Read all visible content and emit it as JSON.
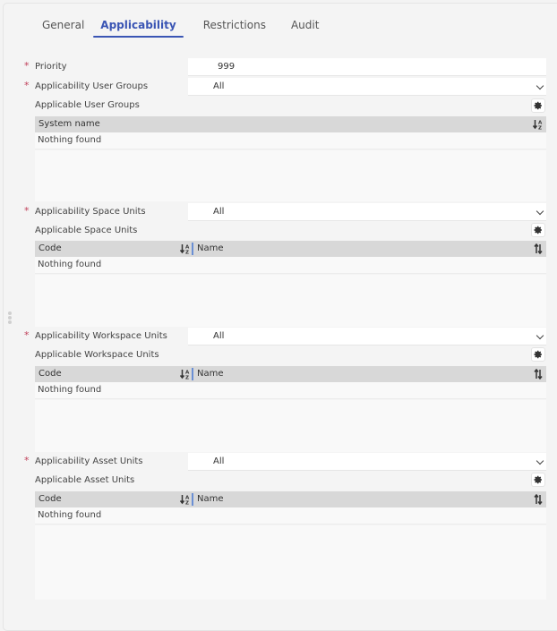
{
  "tabs": [
    {
      "label": "General",
      "active": false
    },
    {
      "label": "Applicability",
      "active": true
    },
    {
      "label": "Restrictions",
      "active": false
    },
    {
      "label": "Audit",
      "active": false
    }
  ],
  "colors": {
    "accent": "#3a55b4",
    "required": "#c0405a",
    "grid_header": "#d8d8d8"
  },
  "priority": {
    "label": "Priority",
    "required": true,
    "value": "999"
  },
  "sections": [
    {
      "select_label": "Applicability User Groups",
      "required": true,
      "select_value": "All",
      "list_label": "Applicable User Groups",
      "columns": [
        "System name"
      ],
      "empty_text": "Nothing found",
      "sort_icon": "sort-alpha-down-icon"
    },
    {
      "select_label": "Applicability Space Units",
      "required": true,
      "select_value": "All",
      "list_label": "Applicable Space Units",
      "columns": [
        "Code",
        "Name"
      ],
      "empty_text": "Nothing found",
      "sort_icon": "sort-arrows-icon"
    },
    {
      "select_label": "Applicability Workspace Units",
      "required": true,
      "select_value": "All",
      "list_label": "Applicable Workspace Units",
      "columns": [
        "Code",
        "Name"
      ],
      "empty_text": "Nothing found",
      "sort_icon": "sort-arrows-icon"
    },
    {
      "select_label": "Applicability Asset Units",
      "required": true,
      "select_value": "All",
      "list_label": "Applicable Asset Units",
      "columns": [
        "Code",
        "Name"
      ],
      "empty_text": "Nothing found",
      "sort_icon": "sort-arrows-icon"
    }
  ],
  "required_marker": "*"
}
